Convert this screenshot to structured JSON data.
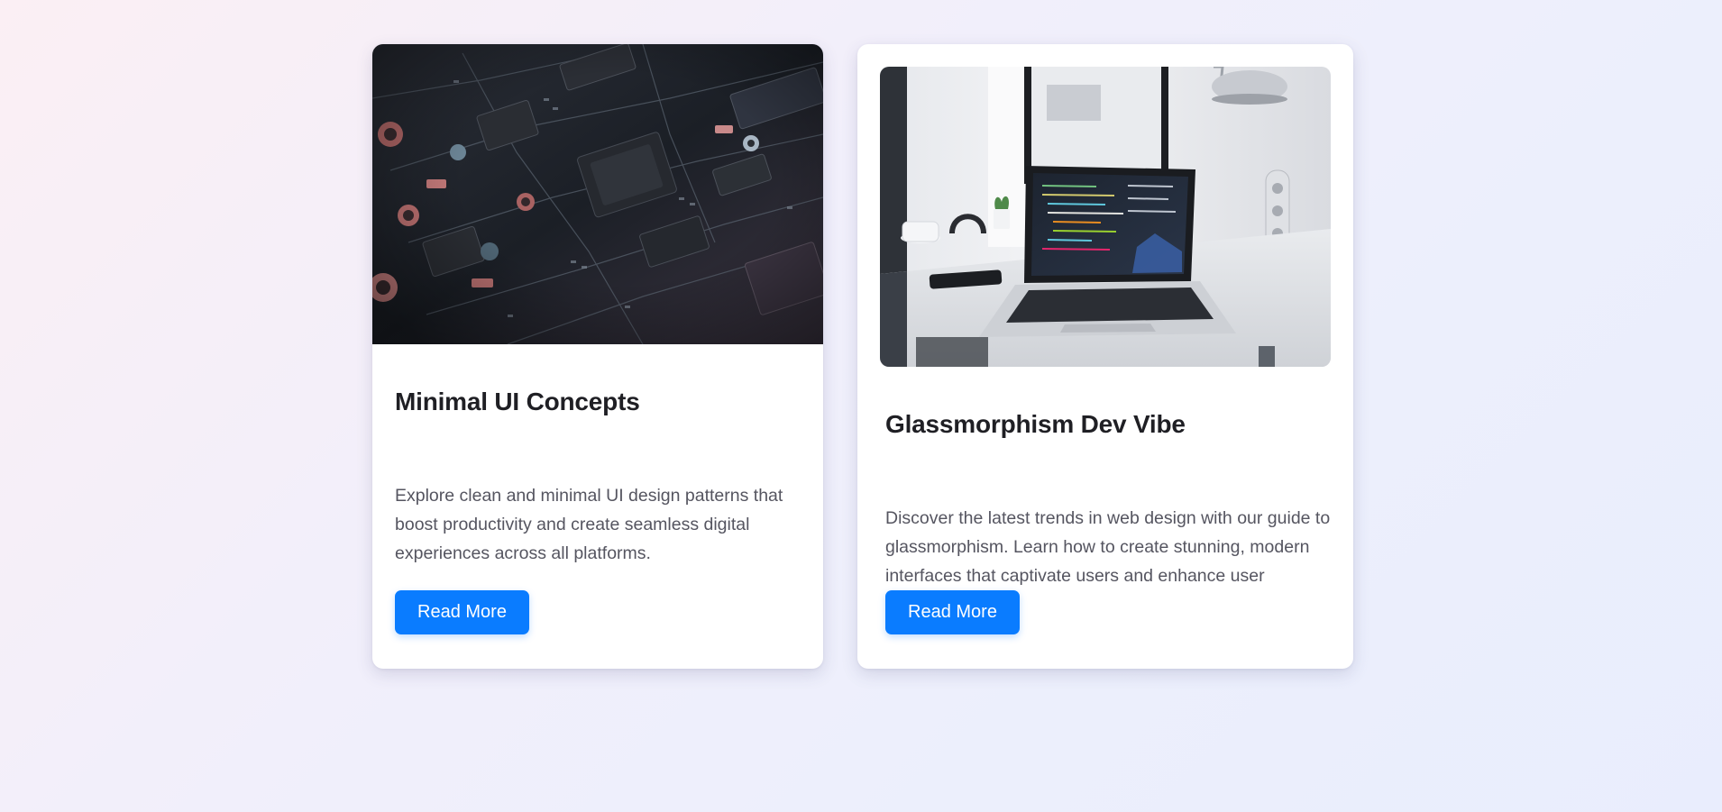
{
  "cards": [
    {
      "image": "circuit-board-photo",
      "title": "Minimal UI Concepts",
      "description": "Explore clean and minimal UI design patterns that boost productivity and create seamless digital experiences across all platforms.",
      "button_label": "Read More"
    },
    {
      "image": "laptop-on-desk-photo",
      "title": "Glassmorphism Dev Vibe",
      "description": "Discover the latest trends in web design with our guide to glassmorphism. Learn how to create stunning, modern interfaces that captivate users and enhance user experience.",
      "button_label": "Read More"
    }
  ],
  "colors": {
    "accent": "#0a7cff",
    "title": "#1f1f24",
    "body_text": "#555560",
    "card_bg": "#ffffff"
  }
}
